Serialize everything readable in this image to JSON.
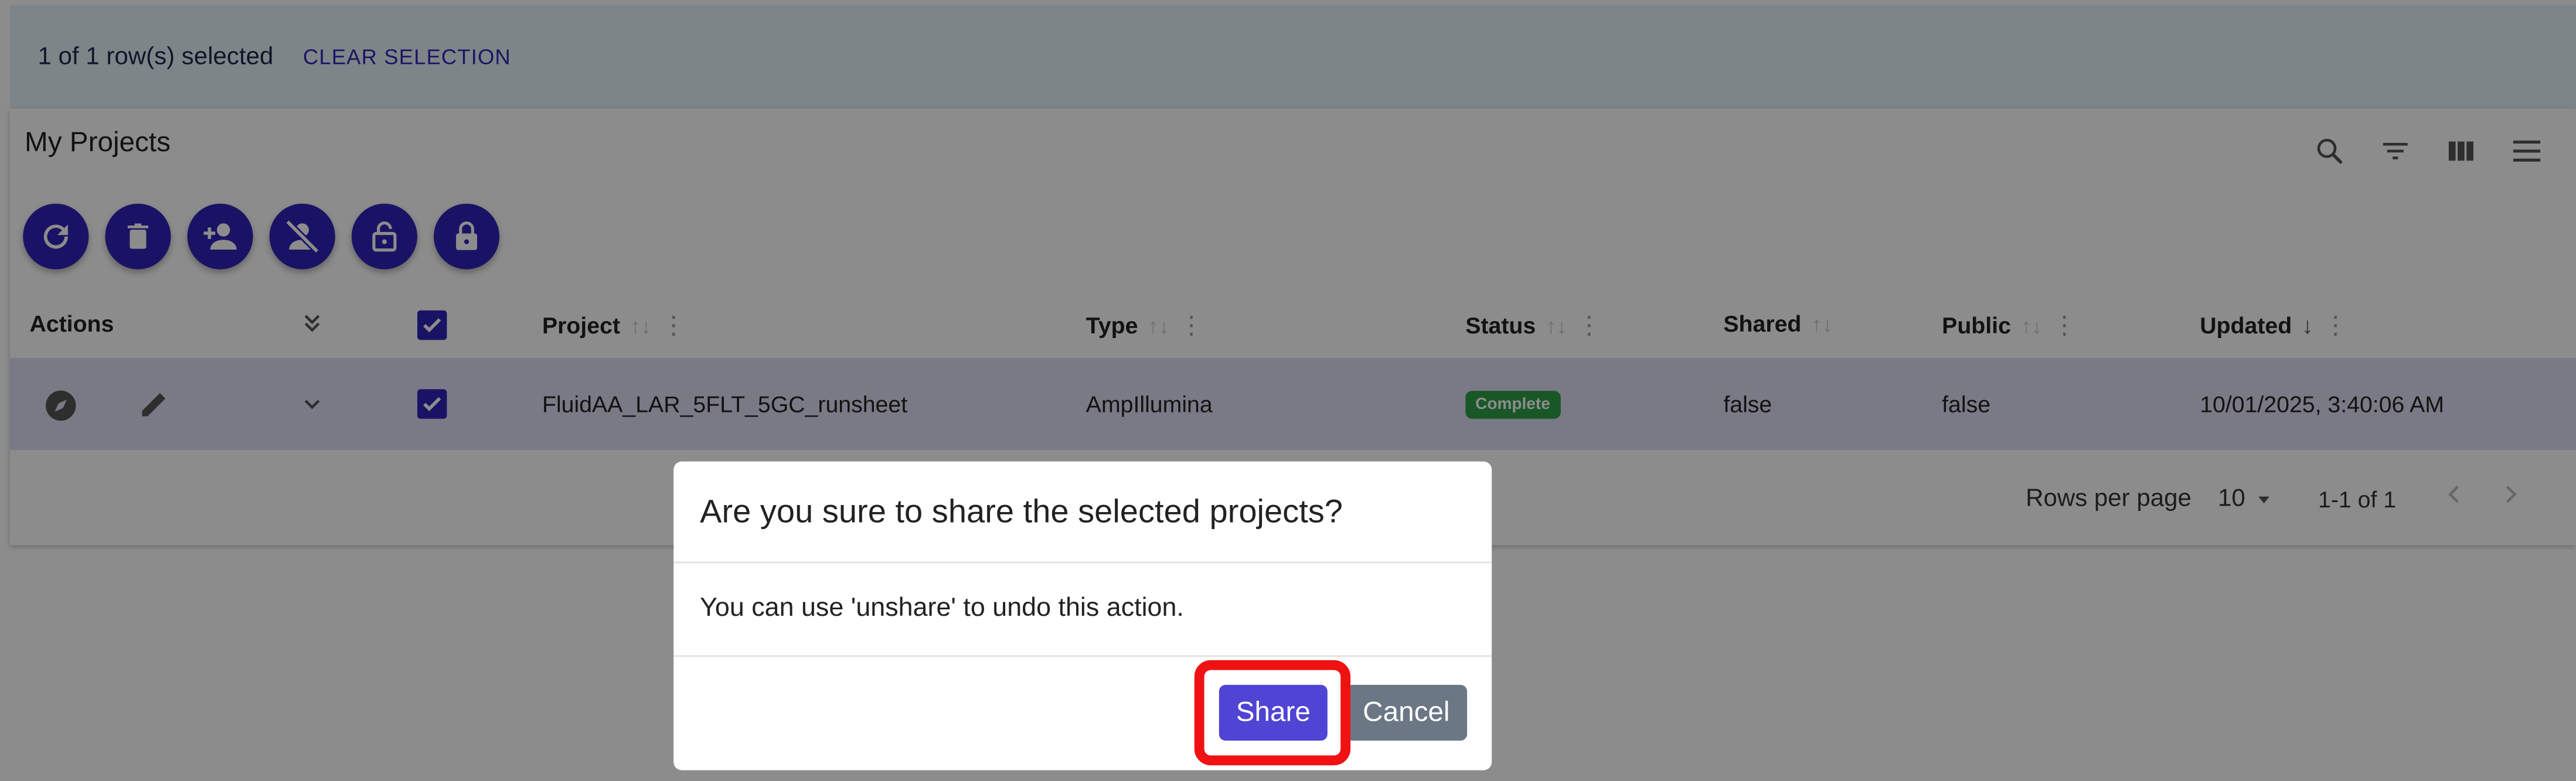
{
  "selection_bar": {
    "count_text": "1 of 1 row(s) selected",
    "clear_label": "CLEAR SELECTION"
  },
  "card": {
    "title": "My Projects",
    "toolbar_icons": [
      "search-icon",
      "filter-icon",
      "columns-icon",
      "menu-icon"
    ],
    "action_icons": [
      "refresh-icon",
      "delete-icon",
      "share-user-icon",
      "unshare-user-icon",
      "unlock-icon",
      "lock-icon"
    ]
  },
  "table": {
    "headers": {
      "actions": "Actions",
      "project": "Project",
      "type": "Type",
      "status": "Status",
      "shared": "Shared",
      "public": "Public",
      "updated": "Updated"
    },
    "rows": [
      {
        "selected": true,
        "project": "FluidAA_LAR_5FLT_5GC_runsheet",
        "type": "AmpIllumina",
        "status": "Complete",
        "shared": "false",
        "public": "false",
        "updated": "10/01/2025, 3:40:06 AM"
      }
    ]
  },
  "pagination": {
    "rows_per_page_label": "Rows per page",
    "rows_per_page_value": "10",
    "range": "1-1 of 1"
  },
  "dialog": {
    "title": "Are you sure to share the selected projects?",
    "body": "You can use 'unshare' to undo this action.",
    "confirm_label": "Share",
    "cancel_label": "Cancel"
  },
  "colors": {
    "primary": "#3024b8",
    "share_button": "#4f44d4",
    "cancel_button": "#6b7785",
    "status_complete": "#2e9e48",
    "highlight": "#f01212"
  }
}
